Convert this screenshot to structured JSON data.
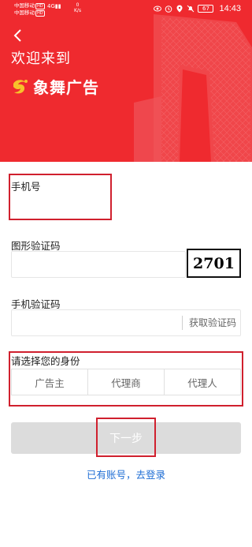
{
  "status_bar": {
    "carrier1": "中国移动",
    "carrier2": "中国移动",
    "hd": "HD",
    "signal": "4G",
    "speed_value": "0",
    "speed_unit": "K/s",
    "battery": "67",
    "time": "14:43"
  },
  "header": {
    "welcome": "欢迎来到",
    "brand_name": "象舞广告",
    "bg_color": "#ef2a2f"
  },
  "form": {
    "phone_label": "手机号",
    "phone_value": "",
    "captcha_label": "图形验证码",
    "captcha_value": "",
    "captcha_code": "2701",
    "sms_label": "手机验证码",
    "sms_value": "",
    "get_code": "获取验证码",
    "identity_label": "请选择您的身份",
    "roles": [
      "广告主",
      "代理商",
      "代理人"
    ]
  },
  "actions": {
    "next": "下一步",
    "login_link": "已有账号，去登录"
  },
  "highlight_color": "#d0202e"
}
